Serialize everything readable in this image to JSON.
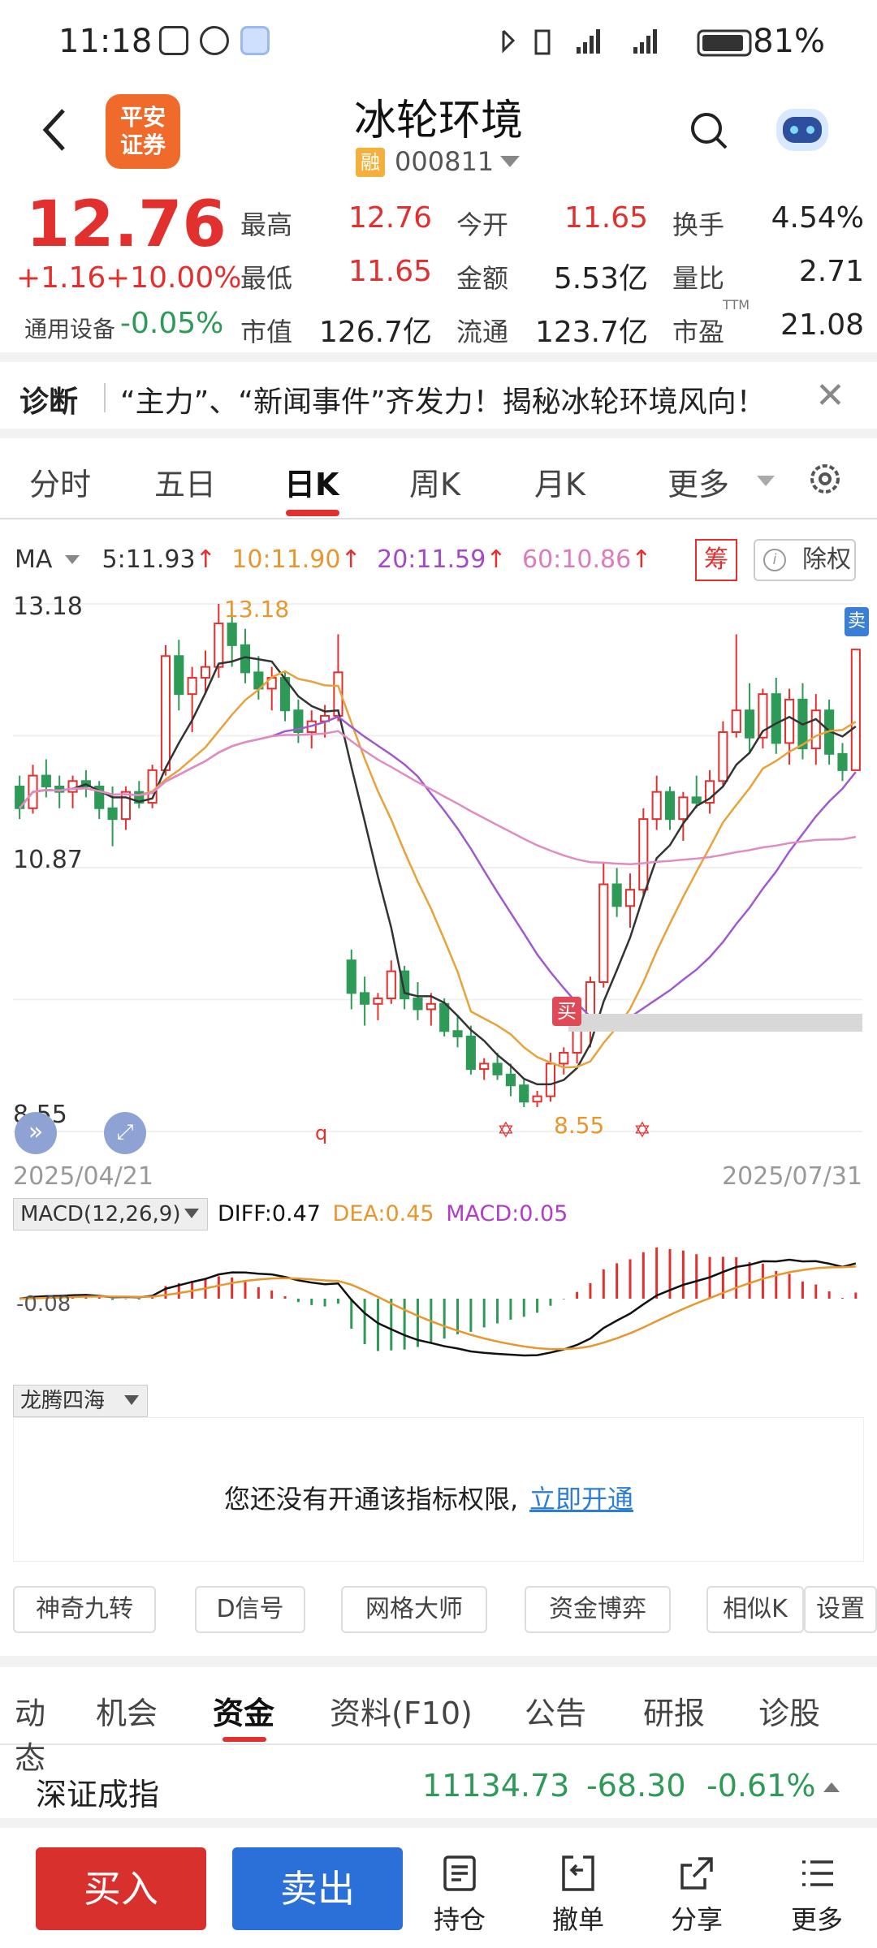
{
  "status_bar": {
    "time": "11:18",
    "battery": "81%"
  },
  "header": {
    "broker_logo": "平安\n证券",
    "stock_name": "冰轮环境",
    "badge": "融",
    "code": "000811"
  },
  "quote": {
    "price": "12.76",
    "change": "+1.16",
    "change_pct": "+10.00%",
    "sector": "通用设备",
    "sector_pct": "-0.05%",
    "fields": [
      {
        "label": "最高",
        "value": "12.76",
        "color": "#e1302e"
      },
      {
        "label": "今开",
        "value": "11.65",
        "color": "#e1302e"
      },
      {
        "label": "换手",
        "value": "4.54%",
        "color": "#222"
      },
      {
        "label": "最低",
        "value": "11.65",
        "color": "#e1302e"
      },
      {
        "label": "金额",
        "value": "5.53亿",
        "color": "#222"
      },
      {
        "label": "量比",
        "value": "2.71",
        "color": "#222"
      },
      {
        "label": "市值",
        "value": "126.7亿",
        "color": "#222"
      },
      {
        "label": "流通",
        "value": "123.7亿",
        "color": "#222"
      },
      {
        "label": "市盈",
        "value": "21.08",
        "color": "#222",
        "sup": "TTM"
      }
    ]
  },
  "news": {
    "title": "诊断",
    "text": "“主力”、“新闻事件”齐发力！揭秘冰轮环境风向！"
  },
  "period_tabs": [
    "分时",
    "五日",
    "日K",
    "周K",
    "月K",
    "更多"
  ],
  "ma": {
    "label": "MA",
    "ma5": "5:11.93",
    "ma10": "10:11.90",
    "ma20": "20:11.59",
    "ma60": "60:10.86",
    "arrow": "↑"
  },
  "chart_buttons": {
    "chou": "筹",
    "chuquan": "除权",
    "info": "i"
  },
  "chart_marks": {
    "buy": "买",
    "sell": "卖",
    "q": "q"
  },
  "chart_data": {
    "type": "candlestick",
    "date_start": "2025/04/21",
    "date_end": "2025/07/31",
    "y_labels": [
      "13.18",
      "10.87",
      "8.55"
    ],
    "high_label": "13.18",
    "low_label": "8.55",
    "ylim": [
      8.55,
      13.18
    ],
    "candles": [
      [
        11.5,
        11.6,
        11.2,
        11.3
      ],
      [
        11.3,
        11.7,
        11.25,
        11.6
      ],
      [
        11.6,
        11.75,
        11.4,
        11.5
      ],
      [
        11.5,
        11.6,
        11.3,
        11.45
      ],
      [
        11.45,
        11.6,
        11.3,
        11.55
      ],
      [
        11.55,
        11.65,
        11.4,
        11.5
      ],
      [
        11.5,
        11.55,
        11.2,
        11.3
      ],
      [
        11.3,
        11.5,
        10.95,
        11.2
      ],
      [
        11.2,
        11.5,
        11.1,
        11.45
      ],
      [
        11.45,
        11.55,
        11.3,
        11.35
      ],
      [
        11.35,
        11.7,
        11.3,
        11.65
      ],
      [
        11.65,
        12.8,
        11.6,
        12.7
      ],
      [
        12.7,
        12.85,
        12.2,
        12.35
      ],
      [
        12.35,
        12.6,
        12.0,
        12.5
      ],
      [
        12.5,
        12.75,
        12.35,
        12.6
      ],
      [
        12.6,
        13.18,
        12.5,
        13.0
      ],
      [
        13.0,
        13.1,
        12.6,
        12.8
      ],
      [
        12.8,
        12.95,
        12.45,
        12.55
      ],
      [
        12.55,
        12.7,
        12.3,
        12.4
      ],
      [
        12.4,
        12.6,
        12.2,
        12.5
      ],
      [
        12.5,
        12.55,
        12.1,
        12.2
      ],
      [
        12.2,
        12.3,
        11.9,
        12.0
      ],
      [
        12.0,
        12.2,
        11.85,
        12.1
      ],
      [
        12.1,
        12.25,
        11.95,
        12.15
      ],
      [
        12.15,
        12.9,
        12.1,
        12.55
      ],
      [
        9.9,
        10.0,
        9.45,
        9.6
      ],
      [
        9.6,
        9.75,
        9.3,
        9.5
      ],
      [
        9.5,
        9.6,
        9.35,
        9.55
      ],
      [
        9.55,
        9.9,
        9.5,
        9.8
      ],
      [
        9.8,
        9.85,
        9.45,
        9.55
      ],
      [
        9.55,
        9.7,
        9.35,
        9.45
      ],
      [
        9.45,
        9.6,
        9.3,
        9.5
      ],
      [
        9.5,
        9.55,
        9.2,
        9.25
      ],
      [
        9.25,
        9.4,
        9.1,
        9.2
      ],
      [
        9.2,
        9.3,
        8.85,
        8.9
      ],
      [
        8.9,
        9.0,
        8.8,
        8.95
      ],
      [
        8.95,
        9.05,
        8.8,
        8.85
      ],
      [
        8.85,
        8.95,
        8.65,
        8.75
      ],
      [
        8.75,
        8.8,
        8.55,
        8.6
      ],
      [
        8.6,
        8.7,
        8.55,
        8.65
      ],
      [
        8.65,
        9.05,
        8.6,
        8.95
      ],
      [
        8.95,
        9.1,
        8.85,
        9.05
      ],
      [
        9.05,
        9.35,
        8.95,
        9.3
      ],
      [
        9.3,
        9.75,
        9.1,
        9.7
      ],
      [
        9.7,
        10.8,
        9.65,
        10.6
      ],
      [
        10.6,
        10.75,
        10.3,
        10.4
      ],
      [
        10.4,
        10.7,
        10.2,
        10.55
      ],
      [
        10.55,
        11.3,
        10.5,
        11.2
      ],
      [
        11.2,
        11.6,
        11.1,
        11.45
      ],
      [
        11.45,
        11.5,
        11.1,
        11.2
      ],
      [
        11.2,
        11.45,
        11.0,
        11.4
      ],
      [
        11.4,
        11.6,
        11.3,
        11.35
      ],
      [
        11.35,
        11.65,
        11.25,
        11.55
      ],
      [
        11.55,
        12.1,
        11.5,
        12.0
      ],
      [
        12.0,
        12.9,
        11.95,
        12.2
      ],
      [
        12.2,
        12.45,
        11.8,
        11.95
      ],
      [
        11.95,
        12.4,
        11.85,
        12.35
      ],
      [
        12.35,
        12.5,
        11.8,
        11.9
      ],
      [
        11.9,
        12.4,
        11.7,
        12.3
      ],
      [
        12.3,
        12.45,
        11.75,
        11.85
      ],
      [
        11.85,
        12.35,
        11.7,
        12.2
      ],
      [
        12.2,
        12.3,
        11.7,
        11.8
      ],
      [
        11.8,
        11.9,
        11.55,
        11.65
      ],
      [
        11.65,
        12.76,
        11.65,
        12.76
      ]
    ],
    "macd_label": "-0.08",
    "macd": {
      "selector": "MACD(12,26,9)",
      "diff": "DIFF:0.47",
      "dea": "DEA:0.45",
      "macd": "MACD:0.05"
    }
  },
  "indicator_panel": {
    "selector": "龙腾四海",
    "text": "您还没有开通该指标权限,",
    "link": "立即开通"
  },
  "tools": [
    "神奇九转",
    "D信号",
    "网格大师",
    "资金博弈",
    "相似K",
    "设置"
  ],
  "info_tabs": [
    "动态",
    "机会",
    "资金",
    "资料(F10)",
    "公告",
    "研报",
    "诊股"
  ],
  "index": {
    "name": "深证成指",
    "value": "11134.73",
    "change": "-68.30",
    "pct": "-0.61%"
  },
  "bottom_bar": {
    "buy": "买入",
    "sell": "卖出",
    "items": [
      "持仓",
      "撤单",
      "分享",
      "更多"
    ]
  },
  "colors": {
    "up": "#e1302e",
    "down": "#2e9a57",
    "ma5": "#333333",
    "ma10": "#e8a23a",
    "ma20": "#a05ad0",
    "ma60": "#e08cc0"
  }
}
